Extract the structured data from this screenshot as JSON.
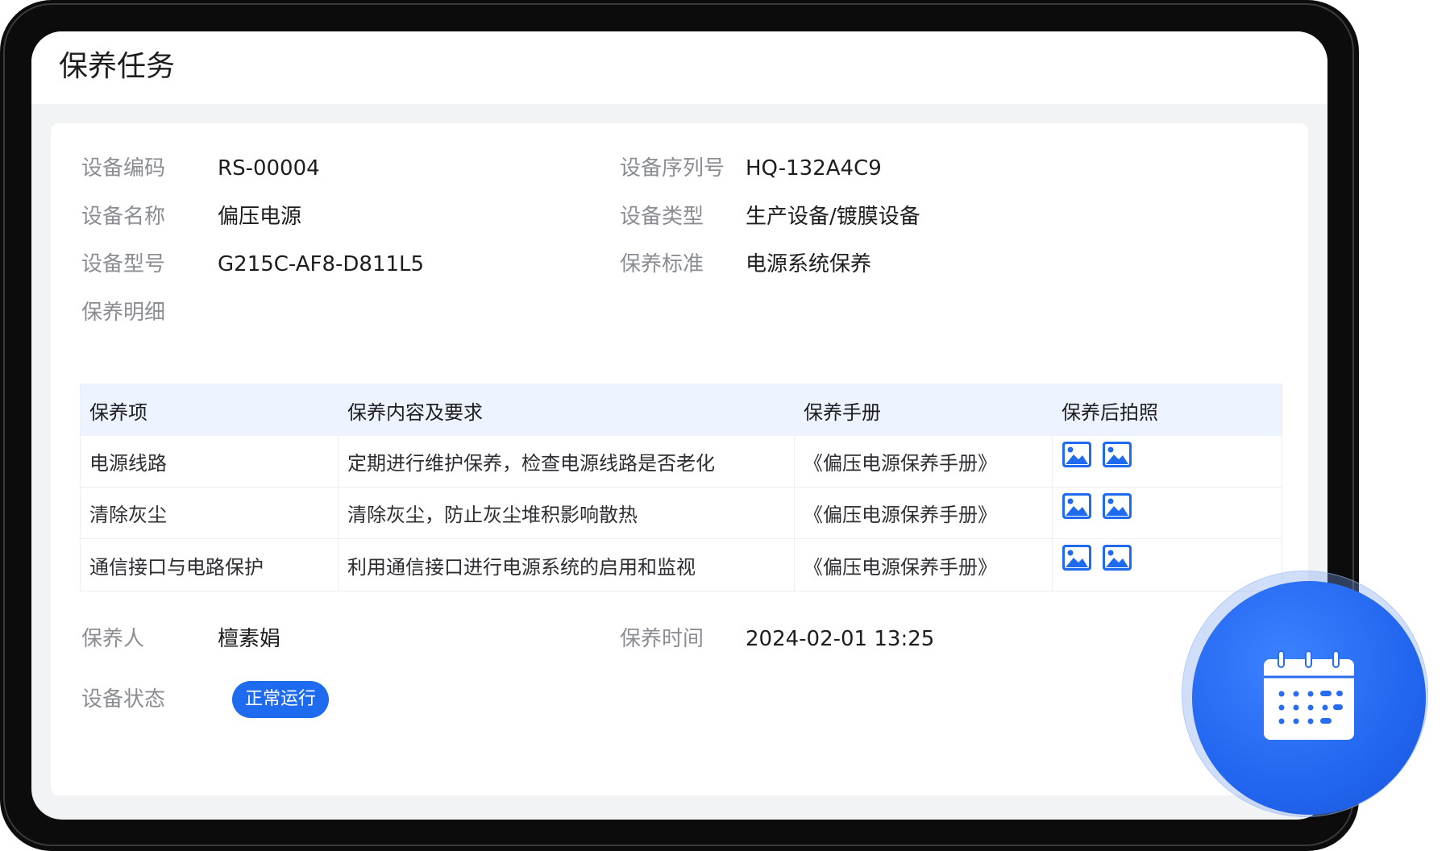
{
  "page": {
    "title": "保养任务"
  },
  "info": {
    "device_code_label": "设备编码",
    "device_code": "RS-00004",
    "serial_label": "设备序列号",
    "serial": "HQ-132A4C9",
    "device_name_label": "设备名称",
    "device_name": "偏压电源",
    "device_type_label": "设备类型",
    "device_type": "生产设备/镀膜设备",
    "model_label": "设备型号",
    "model": "G215C-AF8-D811L5",
    "standard_label": "保养标准",
    "standard": "电源系统保养",
    "details_label": "保养明细"
  },
  "table": {
    "headers": [
      "保养项",
      "保养内容及要求",
      "保养手册",
      "保养后拍照"
    ],
    "rows": [
      {
        "item": "电源线路",
        "content": "定期进行维护保养，检查电源线路是否老化",
        "manual": "《偏压电源保养手册》",
        "photos": 2
      },
      {
        "item": "清除灰尘",
        "content": "清除灰尘，防止灰尘堆积影响散热",
        "manual": "《偏压电源保养手册》",
        "photos": 2
      },
      {
        "item": "通信接口与电路保护",
        "content": "利用通信接口进行电源系统的启用和监视",
        "manual": "《偏压电源保养手册》",
        "photos": 2
      }
    ]
  },
  "footer_info": {
    "maintainer_label": "保养人",
    "maintainer": "檀素娟",
    "time_label": "保养时间",
    "time": "2024-02-01 13:25",
    "status_label": "设备状态",
    "status": "正常运行"
  },
  "icons": {
    "photo": "image-icon",
    "fab": "calendar-icon"
  },
  "colors": {
    "accent": "#1f6bf0",
    "table_header_bg": "#eef4ff"
  }
}
